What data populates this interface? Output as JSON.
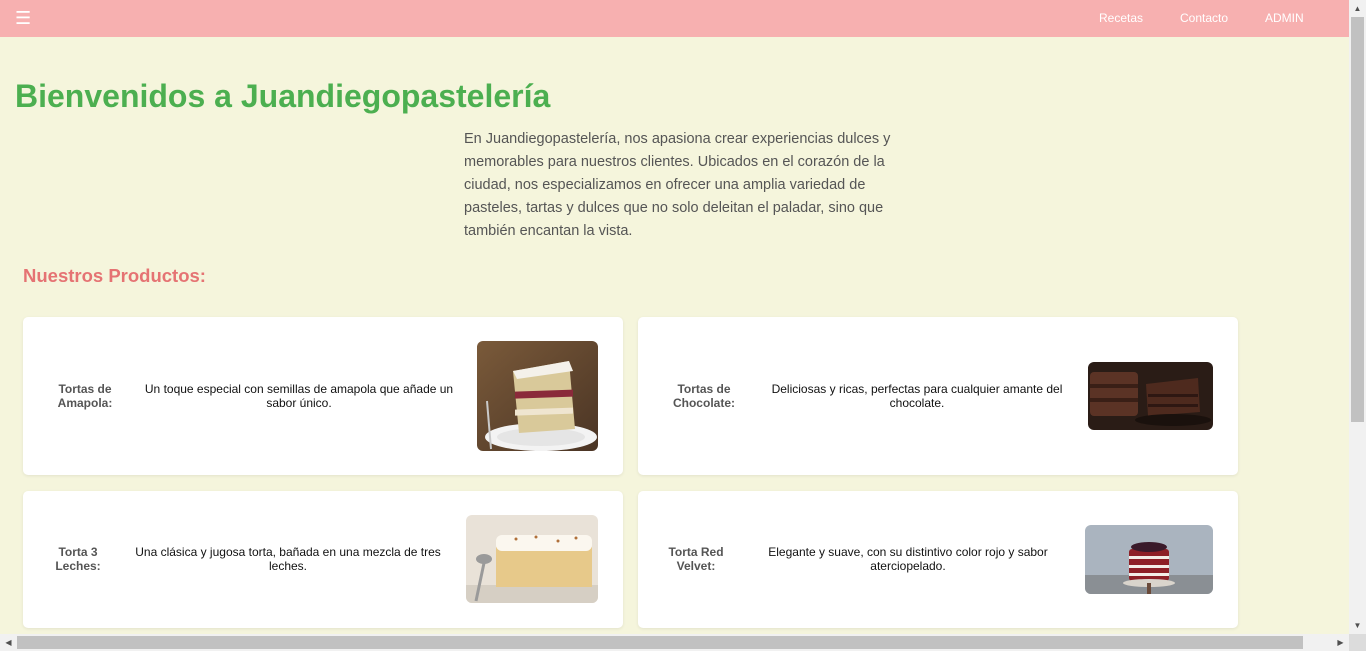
{
  "nav": {
    "menu_icon": "menu-icon",
    "links": [
      "Recetas",
      "Contacto",
      "ADMIN"
    ]
  },
  "hero": {
    "title": "Bienvenidos a Juandiegopastelería",
    "intro": "En Juandiegopastelería, nos apasiona crear experiencias dulces y memorables para nuestros clientes. Ubicados en el corazón de la ciudad, nos especializamos en ofrecer una amplia variedad de pasteles, tartas y dulces que no solo deleitan el paladar, sino que también encantan la vista."
  },
  "products": {
    "title": "Nuestros Productos:",
    "items": [
      {
        "name": "Tortas de Amapola:",
        "description": "Un toque especial con semillas de amapola que añade un sabor único.",
        "image": "poppy-seed-cake-photo"
      },
      {
        "name": "Tortas de Chocolate:",
        "description": "Deliciosas y ricas, perfectas para cualquier amante del chocolate.",
        "image": "chocolate-cake-photo"
      },
      {
        "name": "Torta 3 Leches:",
        "description": "Una clásica y jugosa torta, bañada en una mezcla de tres leches.",
        "image": "tres-leches-cake-photo"
      },
      {
        "name": "Torta Red Velvet:",
        "description": "Elegante y suave, con su distintivo color rojo y sabor aterciopelado.",
        "image": "red-velvet-cake-photo"
      }
    ]
  },
  "colors": {
    "nav_bg": "#f7b0b0",
    "page_bg": "#f5f5dc",
    "title": "#4caf50",
    "section_title": "#e57373"
  }
}
